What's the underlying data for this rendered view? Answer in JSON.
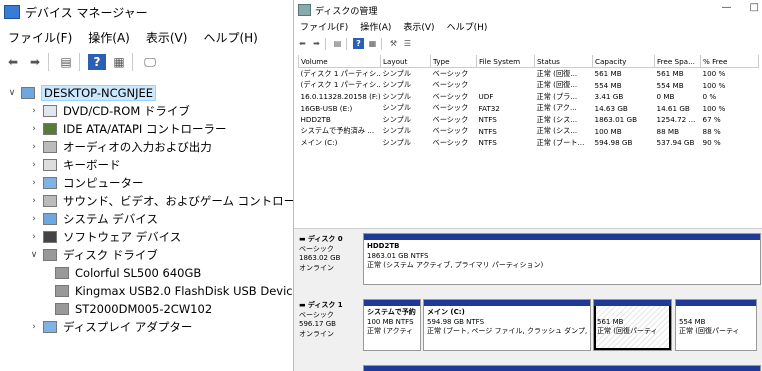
{
  "device_manager": {
    "title": "デバイス マネージャー",
    "menu": [
      "ファイル(F)",
      "操作(A)",
      "表示(V)",
      "ヘルプ(H)"
    ],
    "root": "DESKTOP-NCGNJEE",
    "categories": [
      {
        "label": "DVD/CD-ROM ドライブ",
        "icon": "dvd-drive-icon"
      },
      {
        "label": "IDE ATA/ATAPI コントローラー",
        "icon": "controller-icon"
      },
      {
        "label": "オーディオの入力および出力",
        "icon": "speaker-icon"
      },
      {
        "label": "キーボード",
        "icon": "keyboard-icon"
      },
      {
        "label": "コンピューター",
        "icon": "computer-icon"
      },
      {
        "label": "サウンド、ビデオ、およびゲーム コントローラー",
        "icon": "sound-icon"
      },
      {
        "label": "システム デバイス",
        "icon": "system-device-icon"
      },
      {
        "label": "ソフトウェア デバイス",
        "icon": "software-device-icon"
      },
      {
        "label": "ディスク ドライブ",
        "icon": "disk-drive-icon"
      }
    ],
    "disk_drives": [
      "Colorful SL500 640GB",
      "Kingmax USB2.0 FlashDisk USB Device",
      "ST2000DM005-2CW102"
    ],
    "after": [
      {
        "label": "ディスプレイ アダプター",
        "icon": "display-adapter-icon"
      }
    ]
  },
  "disk_management": {
    "title": "ディスクの管理",
    "menu": [
      "ファイル(F)",
      "操作(A)",
      "表示(V)",
      "ヘルプ(H)"
    ],
    "columns": [
      "Volume",
      "Layout",
      "Type",
      "File System",
      "Status",
      "Capacity",
      "Free Spa...",
      "% Free"
    ],
    "rows": [
      [
        "(ディスク 1 パーティシ...",
        "シンプル",
        "ベーシック",
        "",
        "正常 (回復...",
        "561 MB",
        "561 MB",
        "100 %"
      ],
      [
        "(ディスク 1 パーティシ...",
        "シンプル",
        "ベーシック",
        "",
        "正常 (回復...",
        "554 MB",
        "554 MB",
        "100 %"
      ],
      [
        "16.0.11328.20158 (F:)",
        "シンプル",
        "ベーシック",
        "UDF",
        "正常 (プラ...",
        "3.41 GB",
        "0 MB",
        "0 %"
      ],
      [
        "16GB-USB (E:)",
        "シンプル",
        "ベーシック",
        "FAT32",
        "正常 (アク...",
        "14.63 GB",
        "14.61 GB",
        "100 %"
      ],
      [
        "HDD2TB",
        "シンプル",
        "ベーシック",
        "NTFS",
        "正常 (シス...",
        "1863.01 GB",
        "1254.72 ...",
        "67 %"
      ],
      [
        "システムで予約済み ...",
        "シンプル",
        "ベーシック",
        "NTFS",
        "正常 (シス...",
        "100 MB",
        "88 MB",
        "88 %"
      ],
      [
        "メイン (C:)",
        "シンプル",
        "ベーシック",
        "NTFS",
        "正常 (ブート...",
        "594.98 GB",
        "537.94 GB",
        "90 %"
      ]
    ],
    "disks": [
      {
        "name": "ディスク 0",
        "type": "ベーシック",
        "size": "1863.02 GB",
        "state": "オンライン",
        "partitions": [
          {
            "name": "HDD2TB",
            "size": "1863.01 GB NTFS",
            "status": "正常 (システム アクティブ, プライマリ パーティション)"
          }
        ]
      },
      {
        "name": "ディスク 1",
        "type": "ベーシック",
        "size": "596.17 GB",
        "state": "オンライン",
        "partitions": [
          {
            "name": "システムで予約",
            "size": "100 MB NTFS",
            "status": "正常 (アクティ"
          },
          {
            "name": "メイン (C:)",
            "size": "594.98 GB NTFS",
            "status": "正常 (ブート, ページ ファイル, クラッシュ ダンプ, プライ"
          },
          {
            "name": "",
            "size": "561 MB",
            "status": "正常 (回復パーティ"
          },
          {
            "name": "",
            "size": "554 MB",
            "status": "正常 (回復パーティ"
          }
        ]
      }
    ]
  }
}
